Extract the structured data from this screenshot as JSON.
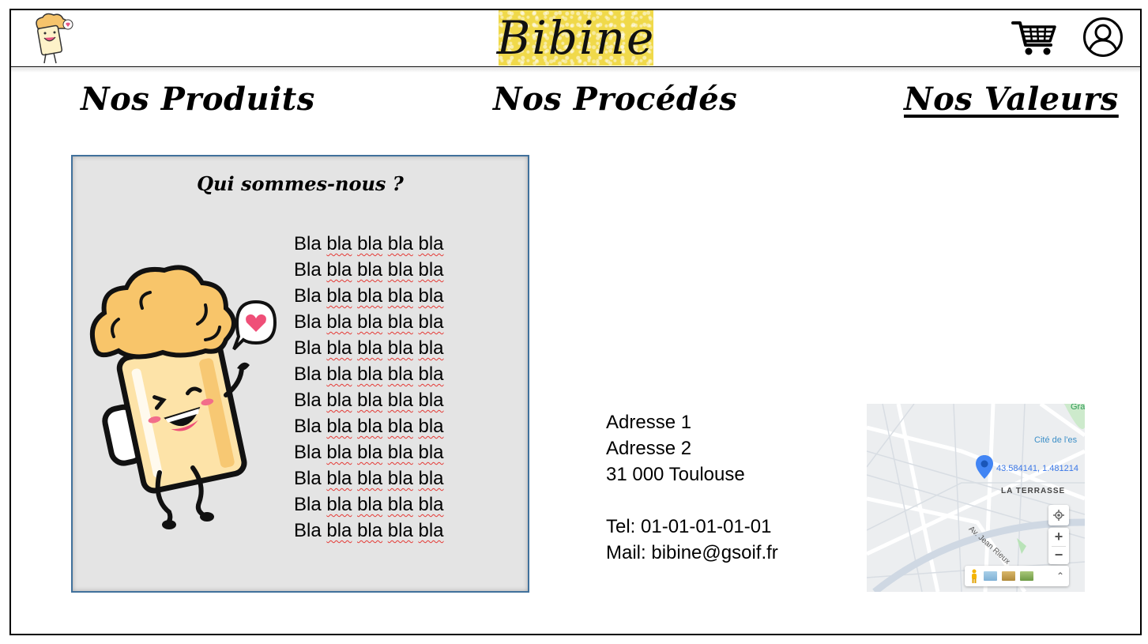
{
  "header": {
    "logo_text": "Bibine",
    "cart_icon": "cart-icon",
    "user_icon": "user-account-icon",
    "mascot_icon": "beer-mascot-icon"
  },
  "nav": {
    "items": [
      {
        "label": "Nos Produits"
      },
      {
        "label": "Nos Procédés"
      },
      {
        "label": "Nos Valeurs",
        "active": true
      }
    ]
  },
  "about": {
    "title": "Qui sommes-nous ?",
    "lines": [
      "Bla bla bla bla bla",
      "Bla bla bla bla bla",
      "Bla bla bla bla bla",
      "Bla bla bla bla bla",
      "Bla bla bla bla bla",
      "Bla bla bla bla bla",
      "Bla bla bla bla bla",
      "Bla bla bla bla bla",
      "Bla bla bla bla bla",
      "Bla bla bla bla bla",
      "Bla bla bla bla bla",
      "Bla bla bla bla bla"
    ]
  },
  "contact": {
    "address1": "Adresse 1",
    "address2": "Adresse 2",
    "city": "31 000 Toulouse",
    "tel": "Tel: 01-01-01-01-01",
    "mail": "Mail: bibine@gsoif.fr"
  },
  "map": {
    "coordinates": "43.584141, 1.481214",
    "place_cite": "Cité de l'es",
    "place_gra": "Gra",
    "place_terrasse": "LA TERRASSE",
    "street": "Av. Jean Rieux",
    "zoom_in": "+",
    "zoom_out": "−",
    "expand": "⌃"
  },
  "colors": {
    "logo_bg": "#f0d94a",
    "panel_bg": "#e4e4e4",
    "panel_border": "#41719c",
    "map_pin": "#4285f4",
    "spell_underline": "#e53935"
  }
}
